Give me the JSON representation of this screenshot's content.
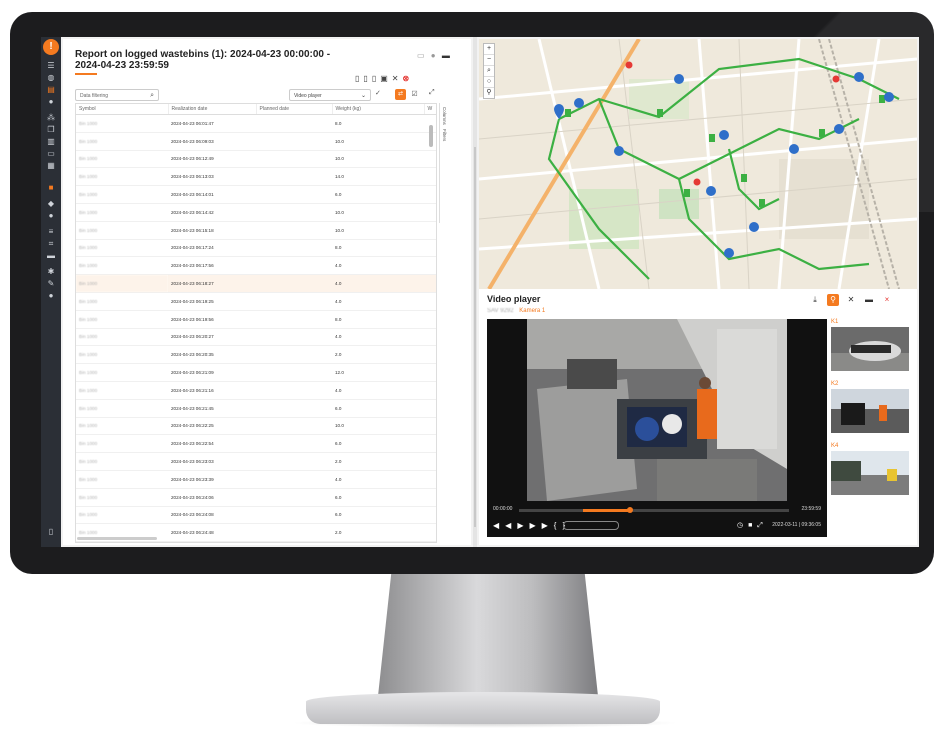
{
  "report": {
    "title": "Report on logged wastebins (1): 2024-04-23 00:00:00 - 2024-04-23 23:59:59",
    "filter_placeholder": "Data filtering",
    "view_select": "Video player",
    "side_tabs": [
      "Columns",
      "Filters"
    ],
    "columns": [
      "Symbol",
      "Realization date",
      "Planned date",
      "Weight (kg)",
      "W"
    ],
    "rows": [
      {
        "symbol": "Bin 1000",
        "date": "2024-04-23 06:01:47",
        "planned": "",
        "weight": "8.0"
      },
      {
        "symbol": "Bin 1000",
        "date": "2024-04-23 06:09:03",
        "planned": "",
        "weight": "10.0"
      },
      {
        "symbol": "Bin 1000",
        "date": "2024-04-23 06:12:49",
        "planned": "",
        "weight": "10.0"
      },
      {
        "symbol": "Bin 1000",
        "date": "2024-04-23 06:13:03",
        "planned": "",
        "weight": "14.0"
      },
      {
        "symbol": "Bin 1000",
        "date": "2024-04-23 06:14:01",
        "planned": "",
        "weight": "6.0"
      },
      {
        "symbol": "Bin 1000",
        "date": "2024-04-23 06:14:42",
        "planned": "",
        "weight": "10.0"
      },
      {
        "symbol": "Bin 1000",
        "date": "2024-04-23 06:15:18",
        "planned": "",
        "weight": "10.0"
      },
      {
        "symbol": "Bin 1000",
        "date": "2024-04-23 06:17:24",
        "planned": "",
        "weight": "8.0"
      },
      {
        "symbol": "Bin 1000",
        "date": "2024-04-23 06:17:56",
        "planned": "",
        "weight": "4.0"
      },
      {
        "symbol": "Bin 1000",
        "date": "2024-04-23 06:18:27",
        "planned": "",
        "weight": "4.0"
      },
      {
        "symbol": "Bin 1000",
        "date": "2024-04-23 06:19:25",
        "planned": "",
        "weight": "4.0"
      },
      {
        "symbol": "Bin 1000",
        "date": "2024-04-23 06:19:56",
        "planned": "",
        "weight": "8.0"
      },
      {
        "symbol": "Bin 1000",
        "date": "2024-04-23 06:20:27",
        "planned": "",
        "weight": "4.0"
      },
      {
        "symbol": "Bin 1000",
        "date": "2024-04-23 06:20:35",
        "planned": "",
        "weight": "2.0"
      },
      {
        "symbol": "Bin 1000",
        "date": "2024-04-23 06:21:09",
        "planned": "",
        "weight": "12.0"
      },
      {
        "symbol": "Bin 1000",
        "date": "2024-04-23 06:21:16",
        "planned": "",
        "weight": "4.0"
      },
      {
        "symbol": "Bin 1000",
        "date": "2024-04-23 06:21:45",
        "planned": "",
        "weight": "6.0"
      },
      {
        "symbol": "Bin 1000",
        "date": "2024-04-23 06:22:25",
        "planned": "",
        "weight": "10.0"
      },
      {
        "symbol": "Bin 1000",
        "date": "2024-04-23 06:22:54",
        "planned": "",
        "weight": "6.0"
      },
      {
        "symbol": "Bin 1000",
        "date": "2024-04-23 06:23:03",
        "planned": "",
        "weight": "2.0"
      },
      {
        "symbol": "Bin 1000",
        "date": "2024-04-23 06:23:39",
        "planned": "",
        "weight": "4.0"
      },
      {
        "symbol": "Bin 1000",
        "date": "2024-04-23 06:24:06",
        "planned": "",
        "weight": "6.0"
      },
      {
        "symbol": "Bin 1000",
        "date": "2024-04-23 06:24:08",
        "planned": "",
        "weight": "6.0"
      },
      {
        "symbol": "Bin 1000",
        "date": "2024-04-23 06:24:48",
        "planned": "",
        "weight": "2.0"
      },
      {
        "symbol": "Bin 1000",
        "date": "2024-04-23 06:24:49",
        "planned": "",
        "weight": "6.0"
      }
    ]
  },
  "video": {
    "title": "Video player",
    "plate": "SAV 9292",
    "camera": "Kamera 1",
    "time_start": "00:00:00",
    "time_end": "23:59:59",
    "timestamp": "2022-03-11 | 09:36:05",
    "progress": 0.41,
    "thumbs": [
      "K1",
      "K2",
      "K4"
    ]
  },
  "colors": {
    "accent": "#f47a20",
    "route": "#3cb043",
    "danger": "#e53935"
  }
}
